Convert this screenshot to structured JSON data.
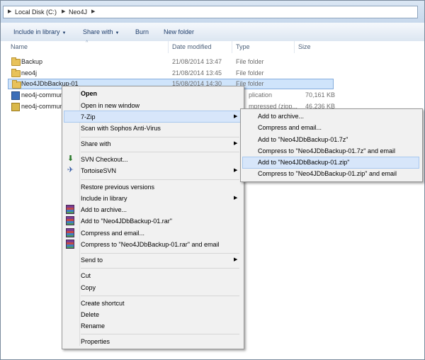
{
  "address_bar": {
    "crumbs": [
      "Local Disk (C:)",
      "Neo4J"
    ]
  },
  "toolbar": {
    "include_in_library": "Include in library",
    "share_with": "Share with",
    "burn": "Burn",
    "new_folder": "New folder"
  },
  "columns": {
    "name": "Name",
    "date_modified": "Date modified",
    "type": "Type",
    "size": "Size"
  },
  "files": [
    {
      "name": "Backup",
      "date": "21/08/2014 13:47",
      "type": "File folder",
      "size": "",
      "icon": "folder-icon"
    },
    {
      "name": "neo4j",
      "date": "21/08/2014 13:45",
      "type": "File folder",
      "size": "",
      "icon": "folder-icon"
    },
    {
      "name": "Neo4JDbBackup-01",
      "date": "15/08/2014 14:30",
      "type": "File folder",
      "size": "",
      "icon": "folder-icon",
      "selected": true
    },
    {
      "name": "neo4j-commun",
      "date": "",
      "type": "plication",
      "size": "70,161 KB",
      "icon": "app-icon"
    },
    {
      "name": "neo4j-commun",
      "date": "",
      "type": "mpressed (zipp...",
      "size": "46,236 KB",
      "icon": "zip-icon"
    }
  ],
  "context_menu": {
    "open": "Open",
    "open_new_window": "Open in new window",
    "seven_zip": "7-Zip",
    "scan_sophos": "Scan with Sophos Anti-Virus",
    "share_with": "Share with",
    "svn_checkout": "SVN Checkout...",
    "tortoise_svn": "TortoiseSVN",
    "restore_previous": "Restore previous versions",
    "include_in_library": "Include in library",
    "add_to_archive": "Add to archive...",
    "add_to_rar": "Add to \"Neo4JDbBackup-01.rar\"",
    "compress_email": "Compress and email...",
    "compress_rar_email": "Compress to \"Neo4JDbBackup-01.rar\" and email",
    "send_to": "Send to",
    "cut": "Cut",
    "copy": "Copy",
    "create_shortcut": "Create shortcut",
    "delete": "Delete",
    "rename": "Rename",
    "properties": "Properties"
  },
  "seven_zip_submenu": {
    "add_to_archive": "Add to archive...",
    "compress_email": "Compress and email...",
    "add_to_7z": "Add to \"Neo4JDbBackup-01.7z\"",
    "compress_7z_email": "Compress to \"Neo4JDbBackup-01.7z\" and email",
    "add_to_zip": "Add to \"Neo4JDbBackup-01.zip\"",
    "compress_zip_email": "Compress to \"Neo4JDbBackup-01.zip\" and email"
  },
  "colors": {
    "selection": "#cfe4fb",
    "menu_bg": "#f1f1f1",
    "highlight": "#d7e6fa"
  }
}
